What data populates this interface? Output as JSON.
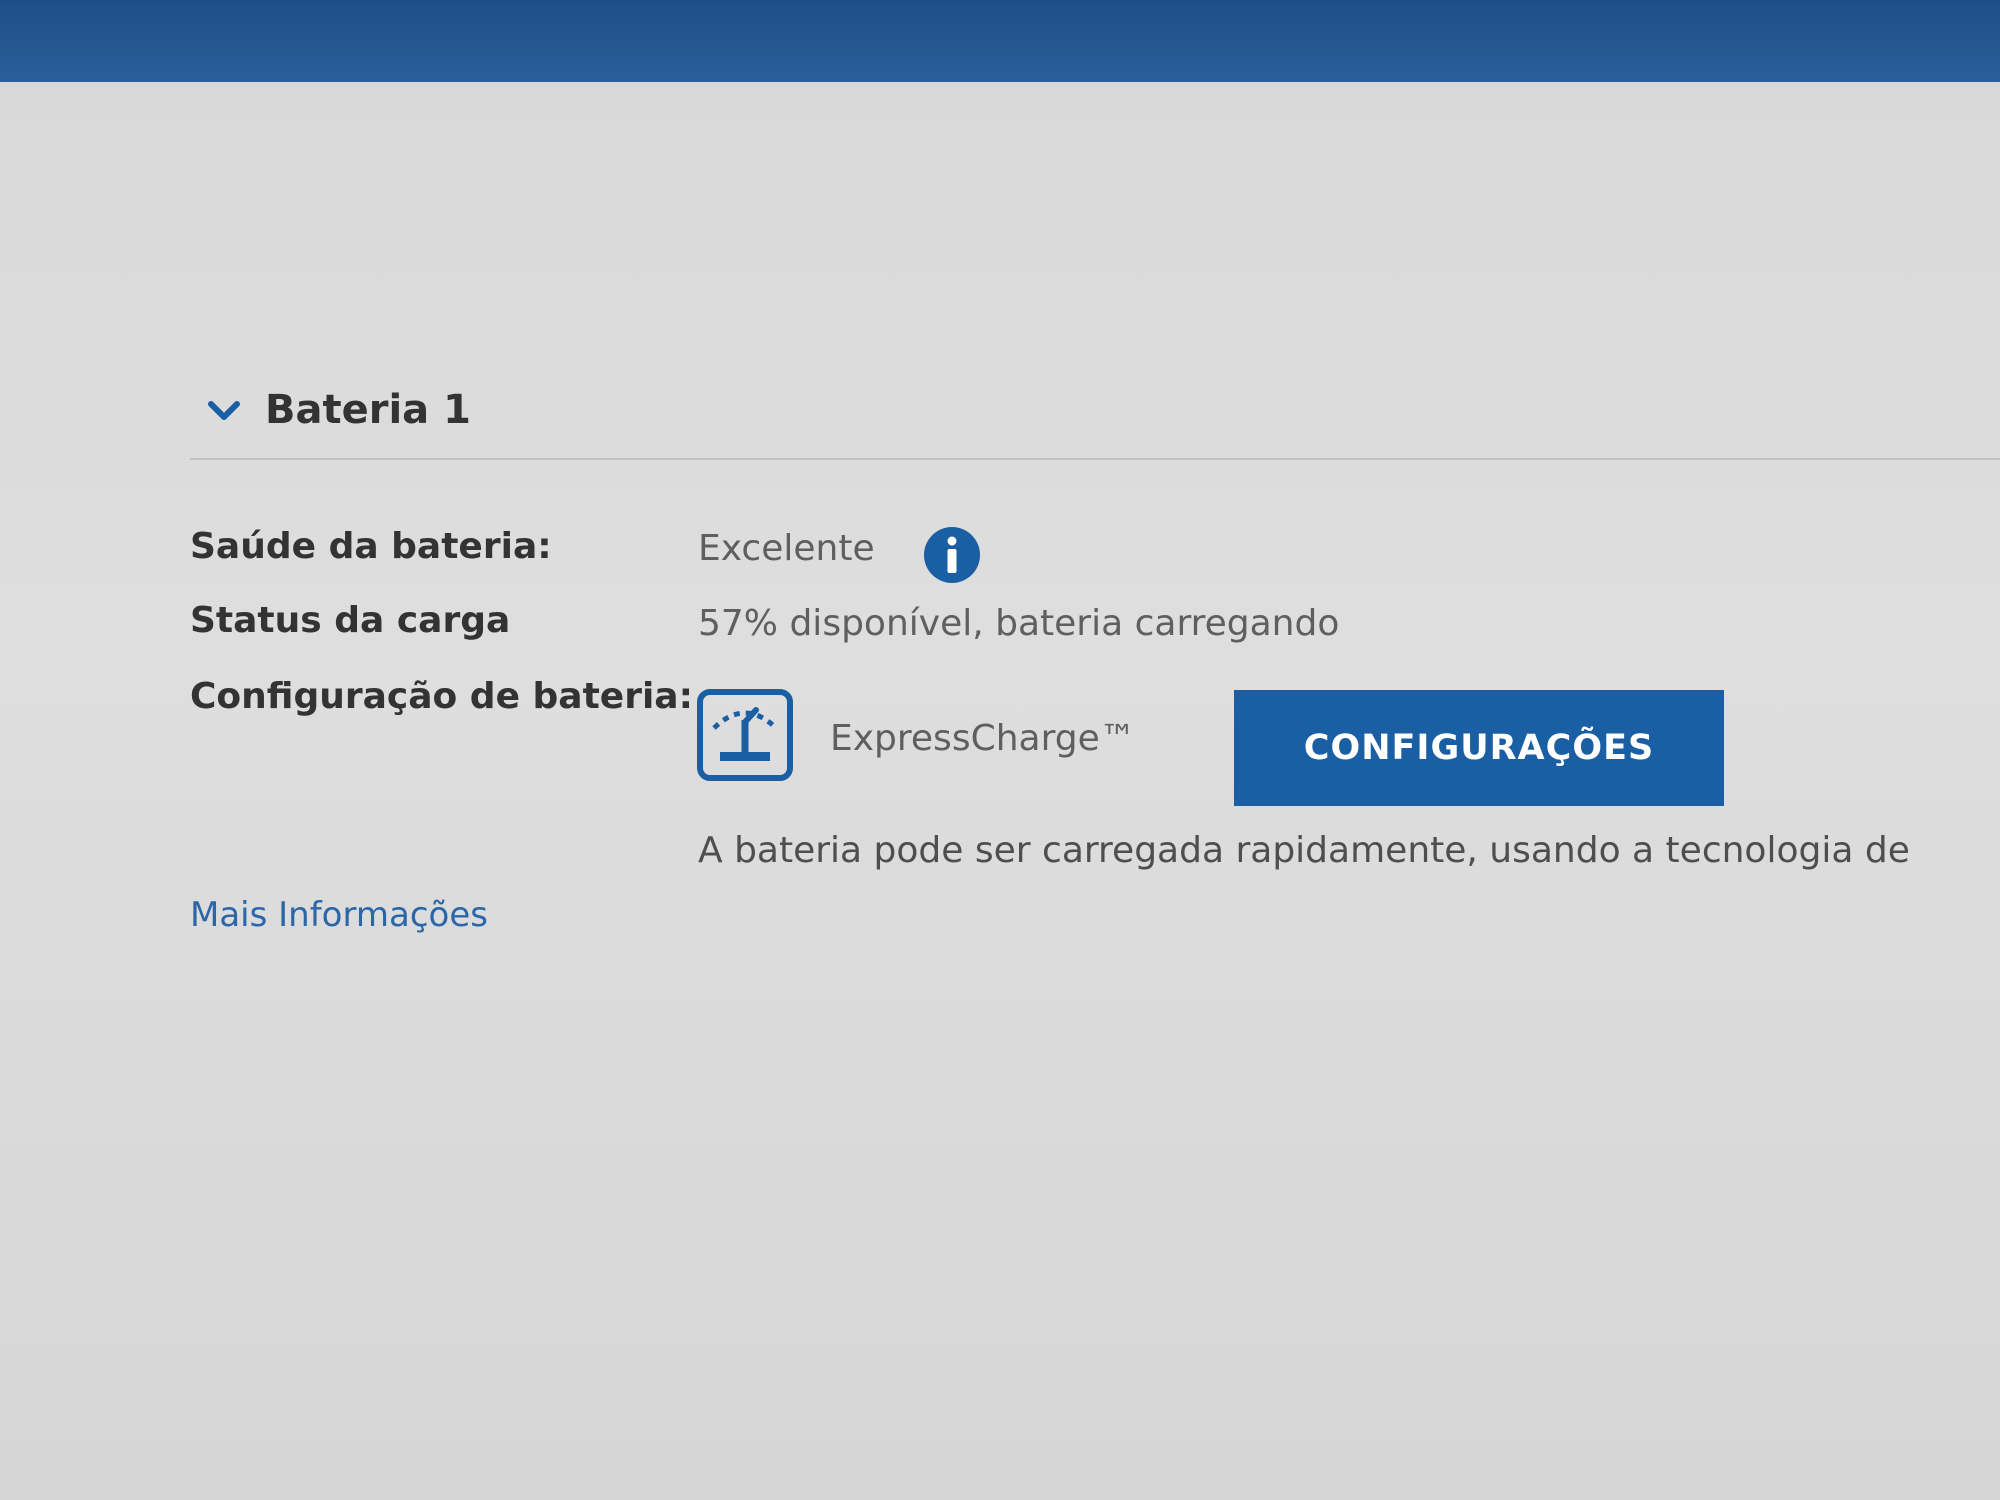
{
  "colors": {
    "top_bar": "#1f4e86",
    "background": "#dcdcdc",
    "accent": "#1a5ea3",
    "link": "#2a66a8",
    "label_text": "#333333",
    "value_text": "#5f5f5f"
  },
  "section": {
    "title": "Bateria 1",
    "expand_icon": "chevron-down-icon"
  },
  "battery": {
    "health": {
      "label": "Saúde da bateria:",
      "value": "Excelente",
      "icon": "info-icon"
    },
    "charge_status": {
      "label": "Status da carga",
      "value": "57% disponível, bateria carregando"
    },
    "configuration": {
      "label": "Configuração de bateria:",
      "mode_icon": "express-charge-icon",
      "mode_name": "ExpressCharge™",
      "button_label": "CONFIGURAÇÕES",
      "description": "A bateria pode ser carregada rapidamente, usando a tecnologia de"
    }
  },
  "more_info_link": "Mais Informações"
}
